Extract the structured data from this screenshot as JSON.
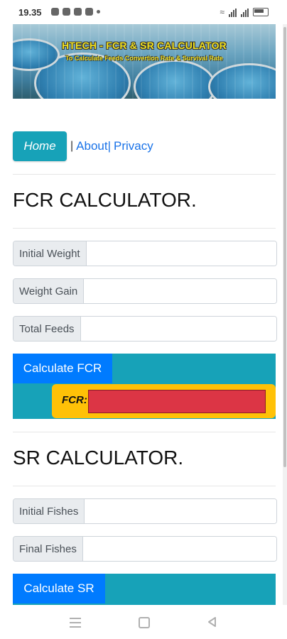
{
  "status_bar": {
    "time": "19.35"
  },
  "banner": {
    "title": "HTECH - FCR & SR CALCULATOR",
    "subtitle": "To Calculate Feeds Convertion Rate & Survival Rate"
  },
  "nav": {
    "home_label": "Home",
    "separator": "|",
    "about_label": "About|",
    "privacy_label": "Privacy"
  },
  "fcr": {
    "heading": "FCR CALCULATOR.",
    "fields": [
      {
        "label": "Initial Weight",
        "value": ""
      },
      {
        "label": "Weight Gain",
        "value": ""
      },
      {
        "label": "Total Feeds",
        "value": ""
      }
    ],
    "calculate_label": "Calculate FCR",
    "result_label": "FCR:",
    "result_value": ""
  },
  "sr": {
    "heading": "SR CALCULATOR.",
    "fields": [
      {
        "label": "Initial Fishes",
        "value": ""
      },
      {
        "label": "Final Fishes",
        "value": ""
      }
    ],
    "calculate_label": "Calculate SR"
  },
  "colors": {
    "teal": "#17a2b8",
    "blue": "#007bff",
    "yellow": "#ffc107",
    "red": "#dc3545",
    "link": "#1a73e8"
  }
}
